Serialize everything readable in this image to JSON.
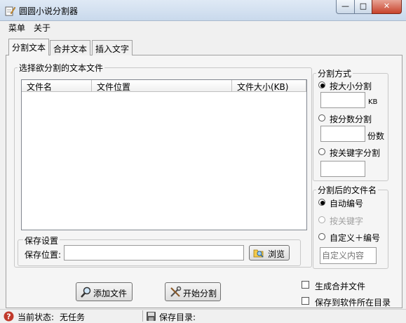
{
  "window": {
    "title": "圆圆小说分割器",
    "min_glyph": "—",
    "max_glyph": "□",
    "close_glyph": "✕"
  },
  "menu": [
    "菜单",
    "关于"
  ],
  "tabs": [
    "分割文本",
    "合并文本",
    "插入文字"
  ],
  "file_group": {
    "label": "选择欲分割的文本文件",
    "columns": [
      "文件名",
      "文件位置",
      "文件大小(KB)"
    ]
  },
  "save_group": {
    "label": "保存设置",
    "location_label": "保存位置:",
    "location_value": "",
    "browse_label": "浏览"
  },
  "split_mode": {
    "label": "分割方式",
    "by_size": "按大小分割",
    "size_unit": "KB",
    "by_count": "按分数分割",
    "count_unit": "份数",
    "by_keyword": "按关键字分割"
  },
  "naming": {
    "label": "分割后的文件名",
    "auto": "自动编号",
    "keyword": "按关键字",
    "custom": "自定义＋编号",
    "custom_placeholder": "自定义内容"
  },
  "actions": {
    "add_file": "添加文件",
    "start_split": "开始分割"
  },
  "options": {
    "merge": "生成合并文件",
    "save_to_software_dir": "保存到软件所在目录"
  },
  "status": {
    "state_label": "当前状态:",
    "state_value": "无任务",
    "dir_label": "保存目录:"
  }
}
